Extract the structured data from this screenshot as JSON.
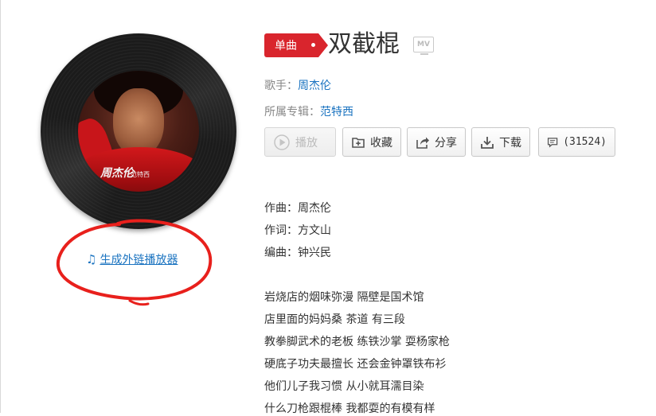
{
  "song": {
    "badge": "单曲",
    "title": "双截棍",
    "mv_label": "MV",
    "singer_label": "歌手：",
    "singer": "周杰伦",
    "album_label": "所属专辑：",
    "album": "范特西"
  },
  "cover": {
    "text_main": "周杰伦",
    "text_sub": "范特西"
  },
  "player_link": {
    "icon": "music-note-icon",
    "label": "生成外链播放器"
  },
  "actions": {
    "play": "播放",
    "collect": "收藏",
    "share": "分享",
    "download": "下载",
    "comments": "(31524)"
  },
  "credits": {
    "composer": "作曲：周杰伦",
    "lyricist": "作词：方文山",
    "arranger": "编曲：钟兴民"
  },
  "lyrics": [
    "岩烧店的烟味弥漫 隔壁是国术馆",
    "店里面的妈妈桑 茶道 有三段",
    "教拳脚武术的老板 练铁沙掌 耍杨家枪",
    "硬底子功夫最擅长 还会金钟罩铁布衫",
    "他们儿子我习惯 从小就耳濡目染",
    "什么刀枪跟棍棒 我都耍的有模有样"
  ],
  "colors": {
    "accent_red": "#d9252d",
    "link_blue": "#1a73c0",
    "annotation_red": "#e8201c"
  }
}
